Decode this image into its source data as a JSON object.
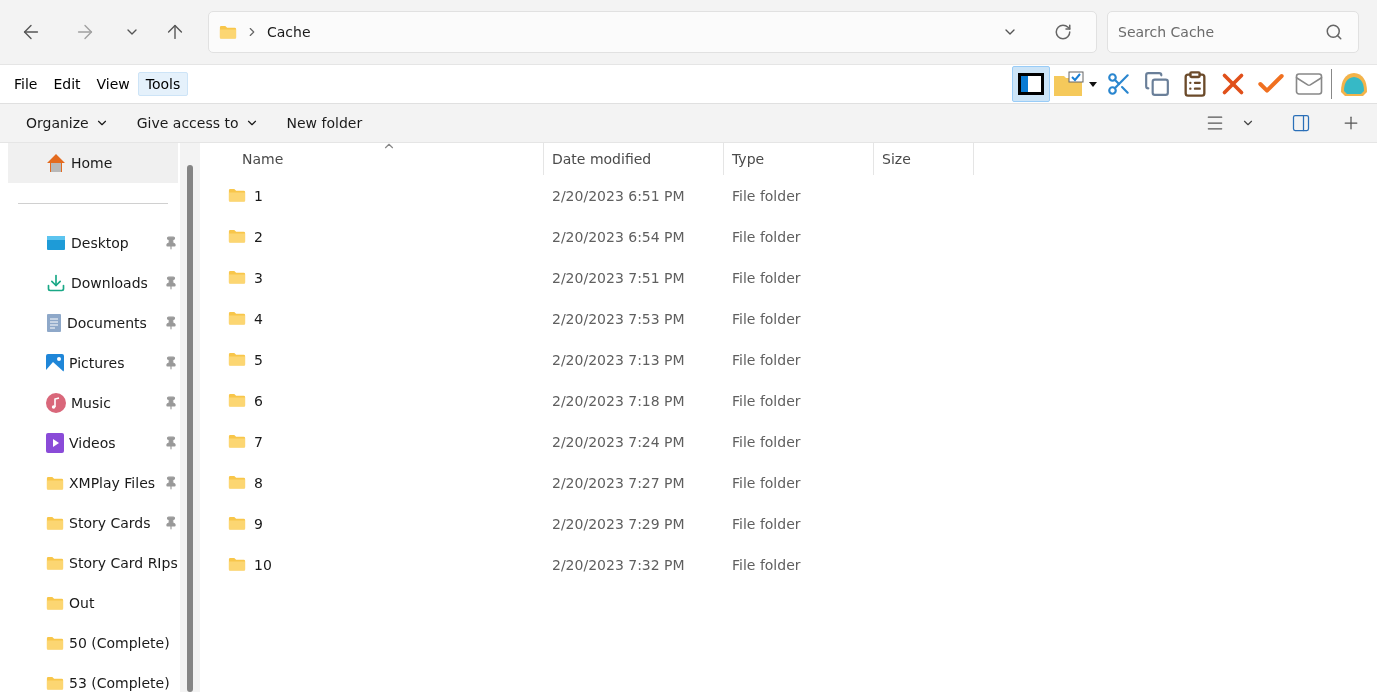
{
  "address": {
    "path": [
      "Cache"
    ]
  },
  "search": {
    "placeholder": "Search Cache"
  },
  "menu": [
    {
      "label": "File",
      "selected": false
    },
    {
      "label": "Edit",
      "selected": false
    },
    {
      "label": "View",
      "selected": false
    },
    {
      "label": "Tools",
      "selected": true
    }
  ],
  "pane_toggle": {
    "on": true
  },
  "tool_icons": [
    {
      "kind": "folder-check"
    },
    {
      "kind": "cut"
    },
    {
      "kind": "copy"
    },
    {
      "kind": "paste"
    },
    {
      "kind": "delete"
    },
    {
      "kind": "check"
    },
    {
      "kind": "mail"
    },
    {
      "kind": "shell"
    }
  ],
  "commands": [
    {
      "label": "Organize",
      "dropdown": true
    },
    {
      "label": "Give access to",
      "dropdown": true
    },
    {
      "label": "New folder",
      "dropdown": false
    }
  ],
  "sidebar": {
    "home": {
      "label": "Home",
      "selected": true
    },
    "items": [
      {
        "kind": "desktop",
        "label": "Desktop",
        "pinned": true
      },
      {
        "kind": "downloads",
        "label": "Downloads",
        "pinned": true
      },
      {
        "kind": "documents",
        "label": "Documents",
        "pinned": true
      },
      {
        "kind": "pictures",
        "label": "Pictures",
        "pinned": true
      },
      {
        "kind": "music",
        "label": "Music",
        "pinned": true
      },
      {
        "kind": "videos",
        "label": "Videos",
        "pinned": true
      },
      {
        "kind": "folder",
        "label": "XMPlay Files",
        "pinned": true
      },
      {
        "kind": "folder",
        "label": "Story Cards",
        "pinned": true
      },
      {
        "kind": "folder",
        "label": "Story Card RIps",
        "pinned": false
      },
      {
        "kind": "folder",
        "label": "Out",
        "pinned": false
      },
      {
        "kind": "folder",
        "label": "50 (Complete)",
        "pinned": false
      },
      {
        "kind": "folder",
        "label": "53 (Complete)",
        "pinned": false
      }
    ]
  },
  "table": {
    "columns": [
      "Name",
      "Date modified",
      "Type",
      "Size"
    ],
    "rows": [
      {
        "name": "1",
        "date": "2/20/2023 6:51 PM",
        "type": "File folder"
      },
      {
        "name": "2",
        "date": "2/20/2023 6:54 PM",
        "type": "File folder"
      },
      {
        "name": "3",
        "date": "2/20/2023 7:51 PM",
        "type": "File folder"
      },
      {
        "name": "4",
        "date": "2/20/2023 7:53 PM",
        "type": "File folder"
      },
      {
        "name": "5",
        "date": "2/20/2023 7:13 PM",
        "type": "File folder"
      },
      {
        "name": "6",
        "date": "2/20/2023 7:18 PM",
        "type": "File folder"
      },
      {
        "name": "7",
        "date": "2/20/2023 7:24 PM",
        "type": "File folder"
      },
      {
        "name": "8",
        "date": "2/20/2023 7:27 PM",
        "type": "File folder"
      },
      {
        "name": "9",
        "date": "2/20/2023 7:29 PM",
        "type": "File folder"
      },
      {
        "name": "10",
        "date": "2/20/2023 7:32 PM",
        "type": "File folder"
      }
    ]
  }
}
